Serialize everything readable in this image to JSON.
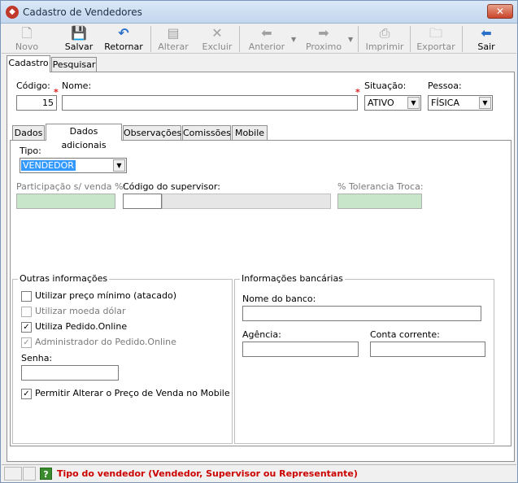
{
  "window": {
    "title": "Cadastro de Vendedores",
    "close_label": "✕"
  },
  "toolbar": {
    "novo": "Novo",
    "salvar": "Salvar",
    "retornar": "Retornar",
    "alterar": "Alterar",
    "excluir": "Excluir",
    "anterior": "Anterior",
    "proximo": "Proximo",
    "imprimir": "Imprimir",
    "exportar": "Exportar",
    "sair": "Sair"
  },
  "main_tabs": [
    "Cadastro",
    "Pesquisar"
  ],
  "header": {
    "codigo_label": "Código:",
    "codigo_value": "15",
    "nome_label": "Nome:",
    "nome_value": "",
    "situacao_label": "Situação:",
    "situacao_value": "ATIVO",
    "pessoa_label": "Pessoa:",
    "pessoa_value": "FÍSICA"
  },
  "sub_tabs": [
    "Dados",
    "Dados adicionais",
    "Observações",
    "Comissões",
    "Mobile"
  ],
  "dados_adicionais": {
    "tipo_label": "Tipo:",
    "tipo_value": "VENDEDOR",
    "participacao_label": "Participação s/ venda %:",
    "supervisor_label": "Código do supervisor:",
    "tolerancia_label": "% Tolerancia Troca:"
  },
  "outras": {
    "title": "Outras informações",
    "preco_minimo": "Utilizar preço mínimo (atacado)",
    "moeda_dolar": "Utilizar moeda dólar",
    "pedido_online": "Utiliza Pedido.Online",
    "admin_pedido": "Administrador do Pedido.Online",
    "senha_label": "Senha:",
    "alterar_preco": "Permitir Alterar o Preço de Venda no Mobile"
  },
  "bancarias": {
    "title": "Informações bancárias",
    "banco_label": "Nome do banco:",
    "agencia_label": "Agência:",
    "conta_label": "Conta corrente:"
  },
  "status": {
    "help_icon": "?",
    "message": "Tipo do vendedor (Vendedor, Supervisor ou Representante)"
  },
  "colors": {
    "readonly_green": "#c8e6c9",
    "status_red": "#cc0000",
    "selection_blue": "#3399ff"
  }
}
